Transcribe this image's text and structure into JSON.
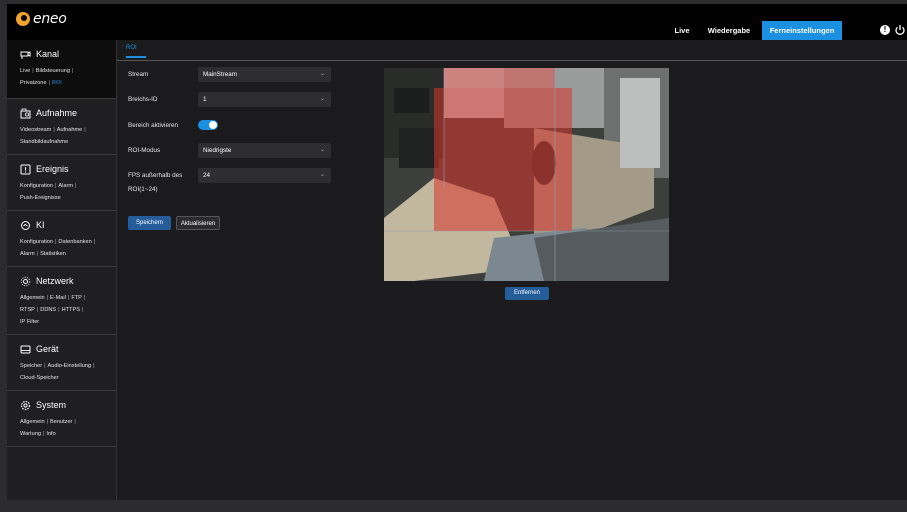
{
  "brand": {
    "name": "eneo",
    "accent": "#1b8fe0",
    "logo_color": "#f2a22c"
  },
  "topnav": {
    "live": "Live",
    "wiedergabe": "Wiedergabe",
    "ferneinstellungen": "Ferneinstellungen",
    "info_icon": "info-icon",
    "power_icon": "power-icon"
  },
  "sidebar": {
    "kanal": {
      "title": "Kanal",
      "icon": "camera-icon",
      "links": [
        "Live",
        "Bildsteuerung",
        "Privatzone",
        "ROI"
      ]
    },
    "aufnahme": {
      "title": "Aufnahme",
      "icon": "recorder-icon",
      "links": [
        "Videostream",
        "Aufnahme",
        "Standbildaufnahme"
      ]
    },
    "ereignis": {
      "title": "Ereignis",
      "icon": "event-icon",
      "links": [
        "Konfiguration",
        "Alarm",
        "Push-Ereignisse"
      ]
    },
    "ki": {
      "title": "KI",
      "icon": "ai-icon",
      "links": [
        "Konfiguration",
        "Datenbanken",
        "Alarm",
        "Statistiken"
      ]
    },
    "netzwerk": {
      "title": "Netzwerk",
      "icon": "network-icon",
      "links": [
        "Allgemein",
        "E-Mail",
        "FTP",
        "RTSP",
        "DDNS",
        "HTTPS",
        "IP Filter"
      ]
    },
    "geraet": {
      "title": "Gerät",
      "icon": "device-icon",
      "links": [
        "Speicher",
        "Audio-Einstellung",
        "Cloud-Speicher"
      ]
    },
    "system": {
      "title": "System",
      "icon": "gear-icon",
      "links": [
        "Allgemein",
        "Benutzer",
        "Wartung",
        "Info"
      ]
    }
  },
  "main": {
    "tab": "ROI",
    "form": {
      "stream_label": "Stream",
      "stream_value": "MainStream",
      "bereich_label": "Breichs-ID",
      "bereich_value": "1",
      "aktivieren_label": "Bereich aktivieren",
      "aktivieren_on": true,
      "modus_label": "ROI-Modus",
      "modus_value": "Niedrigste",
      "fps_label_1": "FPS außerhalb des",
      "fps_label_2": "ROI(1~24)",
      "fps_value": "24"
    },
    "buttons": {
      "save": "Speichern",
      "refresh": "Aktualisieren",
      "remove": "Entfernen"
    },
    "video": {
      "roi_color": "#d9342b"
    }
  }
}
